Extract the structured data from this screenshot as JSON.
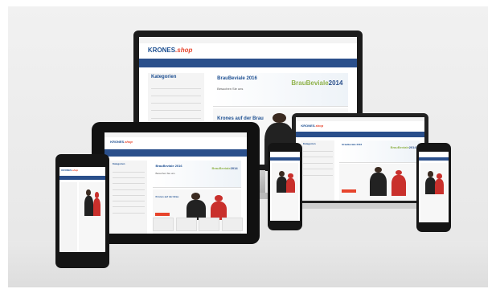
{
  "brand": {
    "logo_main": "KRONES",
    "logo_suffix": ".shop"
  },
  "banner": {
    "title": "BrauBeviale 2016",
    "subtitle": "Besuchen Sie uns",
    "event_logo_main": "BrauBeviale",
    "event_logo_year": "2014"
  },
  "teaser": {
    "title": "Krones auf der Brau"
  },
  "sidebar": {
    "title": "Kategorien"
  },
  "colors": {
    "brand_blue": "#2a4f8b",
    "accent_red": "#e7442c",
    "event_green": "#8fb24a"
  }
}
